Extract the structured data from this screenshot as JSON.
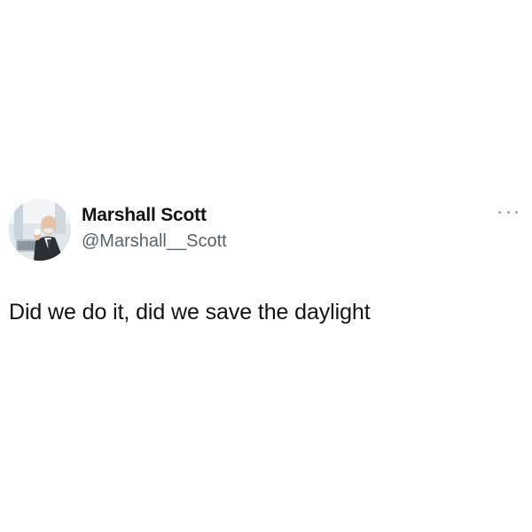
{
  "tweet": {
    "author": {
      "display_name": "Marshall Scott",
      "handle": "@Marshall__Scott",
      "avatar_icon": "user-avatar-photo"
    },
    "more_icon": "more-horizontal-icon",
    "text": "Did we do it, did we save the daylight"
  }
}
